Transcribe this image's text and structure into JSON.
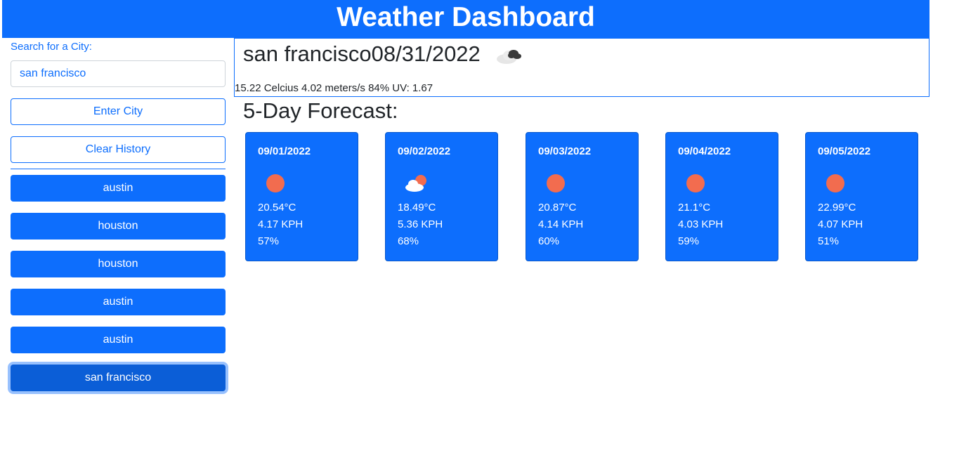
{
  "header": {
    "title": "Weather Dashboard"
  },
  "sidebar": {
    "search_label": "Search for a City:",
    "search_value": "san francisco",
    "enter_label": "Enter City",
    "clear_label": "Clear History",
    "history": [
      {
        "label": "austin"
      },
      {
        "label": "houston"
      },
      {
        "label": "houston"
      },
      {
        "label": "austin"
      },
      {
        "label": "austin"
      },
      {
        "label": "san francisco"
      }
    ]
  },
  "current": {
    "title": "san francisco08/31/2022",
    "icon": "broken-clouds-icon",
    "details": "15.22 Celcius 4.02 meters/s 84% UV: 1.67"
  },
  "forecast": {
    "title": "5-Day Forecast:",
    "days": [
      {
        "date": "09/01/2022",
        "icon": "sun-icon",
        "temp": "20.54°C",
        "wind": "4.17 KPH",
        "humidity": "57%"
      },
      {
        "date": "09/02/2022",
        "icon": "partly-cloudy-icon",
        "temp": "18.49°C",
        "wind": "5.36 KPH",
        "humidity": "68%"
      },
      {
        "date": "09/03/2022",
        "icon": "sun-icon",
        "temp": "20.87°C",
        "wind": "4.14 KPH",
        "humidity": "60%"
      },
      {
        "date": "09/04/2022",
        "icon": "sun-icon",
        "temp": "21.1°C",
        "wind": "4.03 KPH",
        "humidity": "59%"
      },
      {
        "date": "09/05/2022",
        "icon": "sun-icon",
        "temp": "22.99°C",
        "wind": "4.07 KPH",
        "humidity": "51%"
      }
    ]
  },
  "colors": {
    "primary": "#0d6efd",
    "sun": "#f26c4f",
    "active": "#0b5ed7"
  }
}
